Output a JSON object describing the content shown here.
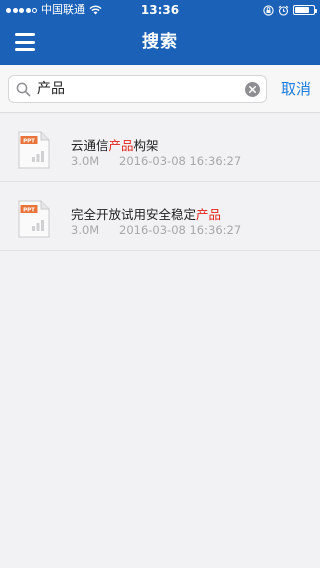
{
  "status_bar": {
    "carrier": "中国联通",
    "time": "13:36",
    "battery_level": 0.8
  },
  "nav": {
    "title": "搜索"
  },
  "search": {
    "query": "产品",
    "cancel_label": "取消"
  },
  "results": [
    {
      "icon": "ppt-file-icon",
      "icon_label": "PPT",
      "name_before": "云通信",
      "name_highlight": "产品",
      "name_after": "构架",
      "size": "3.0M",
      "date": "2016-03-08 16:36:27"
    },
    {
      "icon": "ppt-file-icon",
      "icon_label": "PPT",
      "name_before": "完全开放试用安全稳定",
      "name_highlight": "产品",
      "name_after": "",
      "size": "3.0M",
      "date": "2016-03-08 16:36:27"
    }
  ],
  "colors": {
    "nav_background": "#1b61b8",
    "highlight": "#e2231a",
    "cancel": "#1b7ce0"
  }
}
